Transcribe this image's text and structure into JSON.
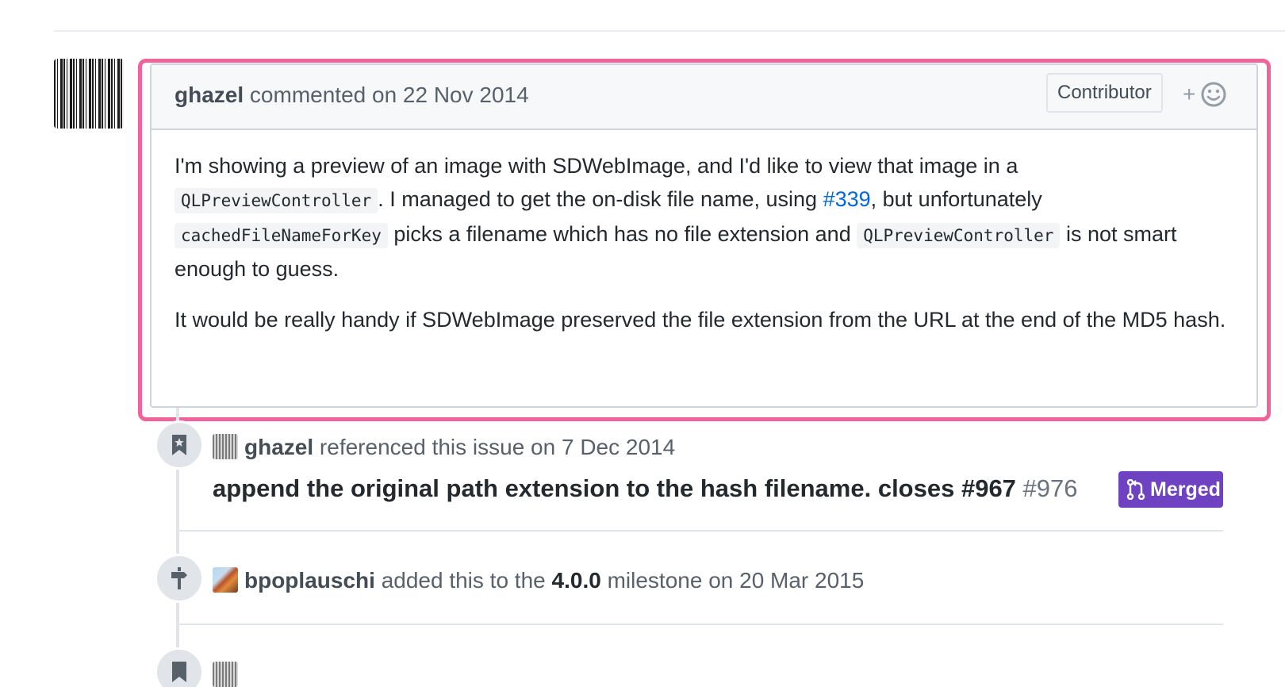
{
  "comment": {
    "author": "ghazel",
    "action": "commented on 22 Nov 2014",
    "role_badge": "Contributor",
    "reaction_plus": "+",
    "paragraph1": {
      "text_1": "I'm showing a preview of an image with SDWebImage, and I'd like to view that image in a",
      "code_1": "QLPreviewController",
      "text_2": ". I managed to get the on-disk file name, using ",
      "link_text": "#339",
      "text_3": ", but unfortunately",
      "code_2": "cachedFileNameForKey",
      "text_4": " picks a filename which has no file extension and ",
      "code_3": "QLPreviewController",
      "text_5": " is not smart enough to guess."
    },
    "paragraph2": "It would be really handy if SDWebImage preserved the file extension from the URL at the end of the MD5 hash."
  },
  "timeline": {
    "reference_event": {
      "icon": "bookmark-icon",
      "actor": "ghazel",
      "action": "referenced this issue on 7 Dec 2014",
      "pr_title": "append the original path extension to the hash filename. closes #967",
      "pr_number": "#976",
      "state_label": "Merged"
    },
    "milestone_event": {
      "icon": "milestone-icon",
      "actor": "bpoplauschi",
      "action_prefix": "added this to the",
      "milestone": "4.0.0",
      "action_suffix": "milestone on 20 Mar 2015"
    }
  },
  "colors": {
    "highlight": "#f0639b",
    "link": "#0366d6",
    "merged": "#6f42c1"
  }
}
